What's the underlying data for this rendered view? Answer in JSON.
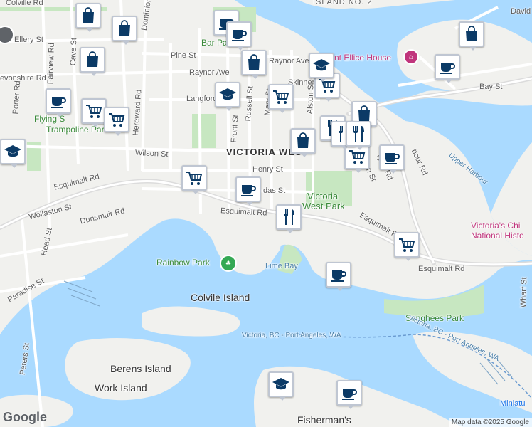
{
  "map": {
    "colors": {
      "water": "#aadaff",
      "land": "#f1f1ee",
      "park": "#c7e7c1",
      "road": "#ffffff",
      "major_road": "#dcdcdc",
      "pin_icon": "#0b3a66"
    },
    "labels": {
      "colville_rd": "Colville Rd",
      "dominion_rd": "Dominion Rd",
      "ellery_st": "Ellery St",
      "cave_st": "Cave St",
      "fairview_rd": "Fairview Rd",
      "devonshire_rd": "Devonshire Rd",
      "porter_rd": "Porter Rd",
      "hereward_rd": "Hereward Rd",
      "flying_squirrel": "Flying S",
      "flying_squirrel_2": "Trampoline Park",
      "pine_st": "Pine St",
      "raynor_ave": "Raynor Ave",
      "langford": "Langford",
      "front_st": "Front St",
      "russell_st": "Russell St",
      "mary_st": "Mary St",
      "skinner": "Skinner",
      "alston_st": "Alston St",
      "barnard_park": "Bar      Park",
      "point_ellice_house": "nt Ellice House",
      "island_no_2": "ISLAND NO. 2",
      "david_st": "David",
      "bay_st": "Bay St",
      "victoria_west": "VICTORIA WES",
      "wilson_st": "Wilson St",
      "henry_st": "Henry St",
      "esquimalt_rd_w": "Esquimalt Rd",
      "esquimalt_rd_c": "Esquimalt Rd",
      "esquimalt_rd_e": "Esquimalt Rd",
      "esquimalt_rd_e2": "Esquimalt Rd",
      "wollaston_st": "Wollaston St",
      "dunsmuir_rd": "Dunsmuir Rd",
      "head_st": "Head St",
      "paradise_st": "Paradise St",
      "dundas_st": "das St",
      "victoria_west_park_1": "Victoria",
      "victoria_west_park_2": "West Park",
      "tyee_rd": "Tyee Rd",
      "harbour_rd": "bour Rd",
      "wilson_st_2": "ilson St",
      "upper_harbour": "Upper Harbour",
      "chinatown_1": "Victoria's Chi",
      "chinatown_2": "National Histo",
      "rainbow_park": "Rainbow Park",
      "lime_bay": "Lime Bay",
      "colvile_island": "Colvile Island",
      "songhees_park": "Songhees Park",
      "wharf_st": "Wharf St",
      "ferry_1": "Victoria, BC - Port Angeles, WA",
      "ferry_2": "Victoria, BC - Port Angeles, WA",
      "berens_island": "Berens Island",
      "work_island": "Work Island",
      "peters_st": "Peters St",
      "fishermans": "Fisherman's",
      "miniature": "Miniatu"
    },
    "pins": [
      {
        "icon": "cafe-icon",
        "label": "cafe"
      },
      {
        "icon": "cafe-icon",
        "label": "cafe"
      },
      {
        "icon": "shopping-bag-icon",
        "label": "shop"
      },
      {
        "icon": "shopping-bag-icon",
        "label": "shop"
      },
      {
        "icon": "shopping-bag-icon",
        "label": "shop"
      },
      {
        "icon": "shopping-bag-icon",
        "label": "shop"
      },
      {
        "icon": "shopping-bag-icon",
        "label": "shop"
      },
      {
        "icon": "shopping-bag-icon",
        "label": "shop"
      },
      {
        "icon": "shopping-bag-icon",
        "label": "shop"
      },
      {
        "icon": "cafe-icon",
        "label": "cafe"
      },
      {
        "icon": "cafe-icon",
        "label": "cafe"
      },
      {
        "icon": "cafe-icon",
        "label": "cafe"
      },
      {
        "icon": "cafe-icon",
        "label": "cafe"
      },
      {
        "icon": "cafe-icon",
        "label": "cafe"
      },
      {
        "icon": "cafe-icon",
        "label": "cafe"
      },
      {
        "icon": "cart-icon",
        "label": "grocery"
      },
      {
        "icon": "cart-icon",
        "label": "grocery"
      },
      {
        "icon": "cart-icon",
        "label": "grocery"
      },
      {
        "icon": "cart-icon",
        "label": "grocery"
      },
      {
        "icon": "cart-icon",
        "label": "grocery"
      },
      {
        "icon": "cart-icon",
        "label": "grocery"
      },
      {
        "icon": "cart-icon",
        "label": "grocery"
      },
      {
        "icon": "school-icon",
        "label": "school"
      },
      {
        "icon": "school-icon",
        "label": "school"
      },
      {
        "icon": "school-icon",
        "label": "school"
      },
      {
        "icon": "school-icon",
        "label": "school"
      },
      {
        "icon": "restaurant-icon",
        "label": "restaurant"
      },
      {
        "icon": "restaurant-icon",
        "label": "restaurant"
      },
      {
        "icon": "restaurant-icon",
        "label": "restaurant"
      },
      {
        "icon": "restaurant-icon",
        "label": "restaurant"
      }
    ],
    "logo": "Google",
    "credit": "Map data ©2025 Google"
  }
}
